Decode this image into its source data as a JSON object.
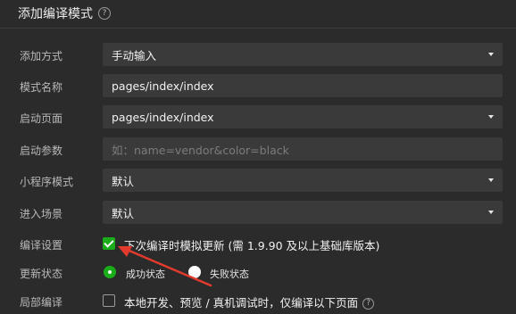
{
  "header": {
    "title": "添加编译模式",
    "help_icon": "question-circle-icon"
  },
  "form": {
    "add_method": {
      "label": "添加方式",
      "value": "手动输入"
    },
    "mode_name": {
      "label": "模式名称",
      "value": "pages/index/index"
    },
    "start_page": {
      "label": "启动页面",
      "value": "pages/index/index"
    },
    "start_params": {
      "label": "启动参数",
      "placeholder": "如：name=vendor&color=black"
    },
    "miniprogram_mode": {
      "label": "小程序模式",
      "value": "默认"
    },
    "scene": {
      "label": "进入场景",
      "value": "默认"
    },
    "compile_settings": {
      "label": "编译设置",
      "option": "下次编译时模拟更新 (需 1.9.90 及以上基础库版本)",
      "checked": true
    },
    "update_status": {
      "label": "更新状态",
      "success": "成功状态",
      "fail": "失败状态",
      "selected": "success"
    },
    "partial_compile": {
      "label": "局部编译",
      "option": "本地开发、预览 / 真机调试时，仅编译以下页面",
      "checked": false
    }
  },
  "colors": {
    "accent": "#1aad19",
    "annotation_arrow": "#e23b2e",
    "background": "#2b2b2b",
    "field": "#3a3a3a"
  }
}
